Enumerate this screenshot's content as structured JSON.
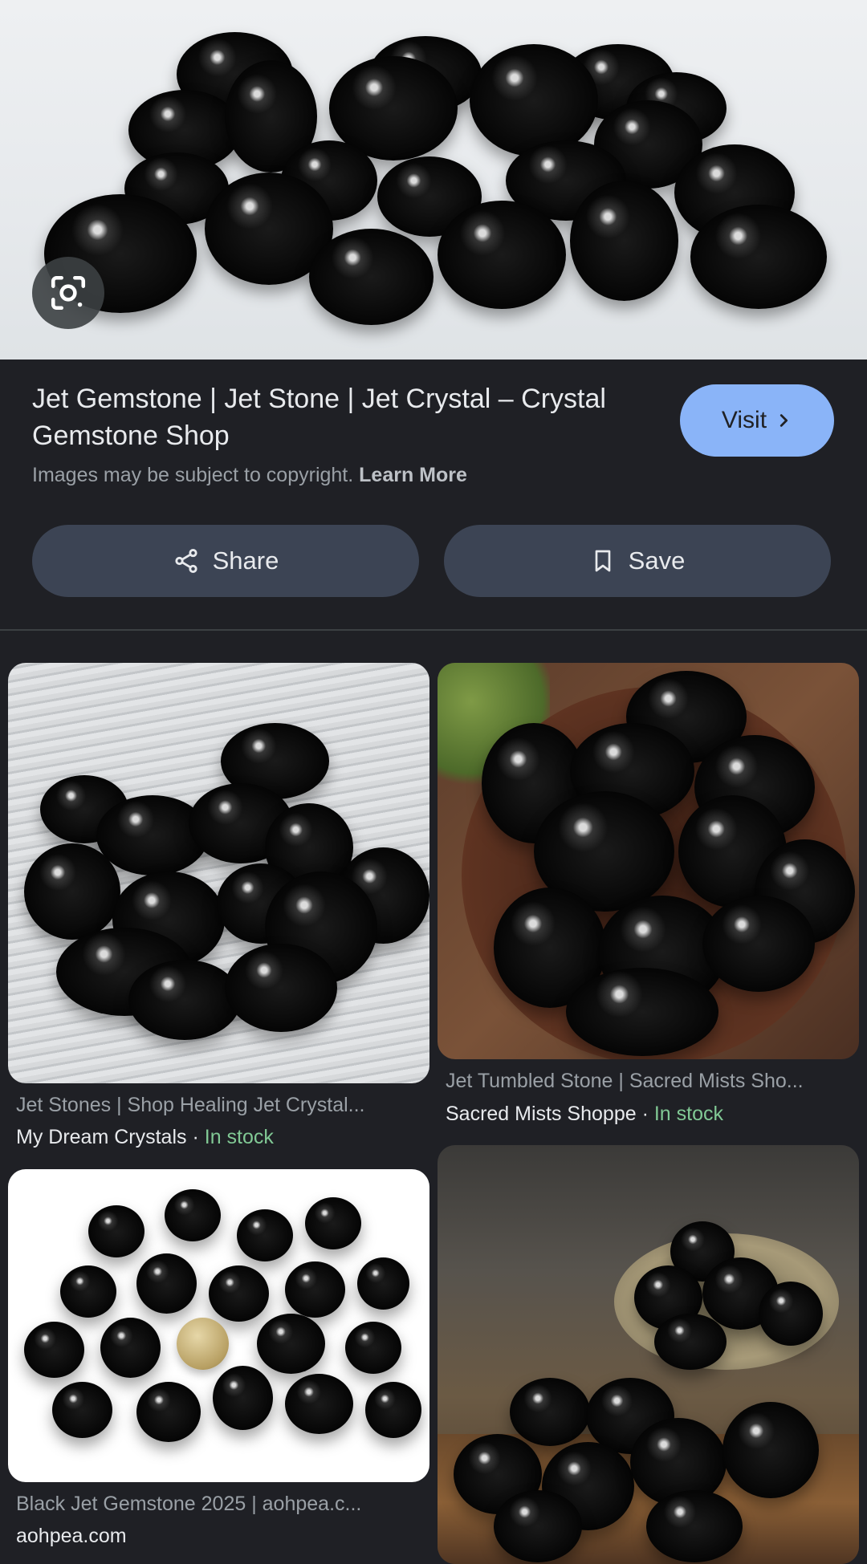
{
  "hero": {
    "lens_icon": "google-lens-icon"
  },
  "result": {
    "title": "Jet Gemstone | Jet Stone | Jet Crystal – Crystal Gemstone Shop",
    "visit_label": "Visit",
    "copyright_text": "Images may be subject to copyright.",
    "learn_more": "Learn More",
    "share_label": "Share",
    "save_label": "Save",
    "colors": {
      "visit_bg": "#8ab4f8",
      "pill_bg": "#3c4454",
      "in_stock": "#81c995"
    }
  },
  "related": [
    {
      "title": "Jet Stones | Shop Healing Jet Crystal...",
      "source": "My Dream Crystals",
      "stock": "In stock"
    },
    {
      "title": "Jet Tumbled Stone | Sacred Mists Sho...",
      "source": "Sacred Mists Shoppe",
      "stock": "In stock"
    },
    {
      "title": "Black Jet Gemstone 2025 | aohpea.c...",
      "source": "aohpea.com"
    }
  ],
  "separator": "·"
}
